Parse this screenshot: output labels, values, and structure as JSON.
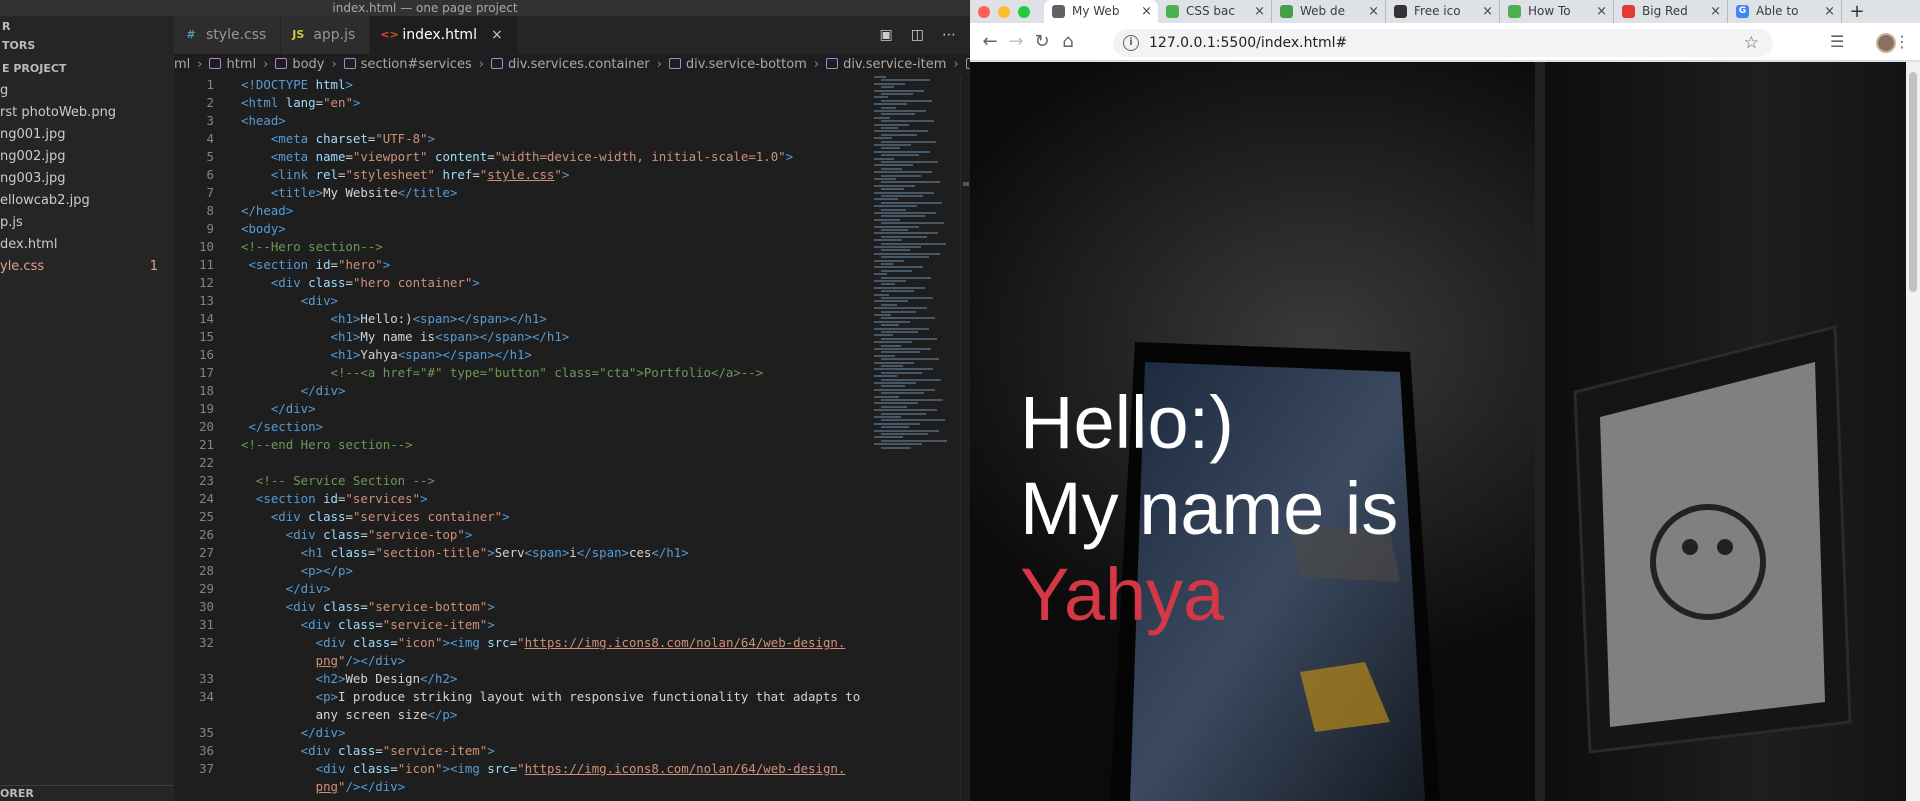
{
  "vscode": {
    "window_title": "index.html — one page project",
    "sidebar": {
      "header": "R",
      "open_editors": "TORS",
      "project": "E PROJECT",
      "files": [
        {
          "name": "g",
          "modified": false,
          "count": ""
        },
        {
          "name": "rst photoWeb.png",
          "modified": false,
          "count": ""
        },
        {
          "name": "ng001.jpg",
          "modified": false,
          "count": ""
        },
        {
          "name": "ng002.jpg",
          "modified": false,
          "count": ""
        },
        {
          "name": "ng003.jpg",
          "modified": false,
          "count": ""
        },
        {
          "name": "ellowcab2.jpg",
          "modified": false,
          "count": ""
        },
        {
          "name": "p.js",
          "modified": false,
          "count": ""
        },
        {
          "name": "dex.html",
          "modified": false,
          "count": ""
        },
        {
          "name": "yle.css",
          "modified": true,
          "count": "1"
        }
      ],
      "outline": "ORER"
    },
    "tabs": [
      {
        "label": "style.css",
        "icon": "css-file-icon",
        "glyph": "#",
        "color": "#519aba",
        "active": false
      },
      {
        "label": "app.js",
        "icon": "js-file-icon",
        "glyph": "JS",
        "color": "#cbcb41",
        "active": false
      },
      {
        "label": "index.html",
        "icon": "html-file-icon",
        "glyph": "<>",
        "color": "#e44d26",
        "active": true
      }
    ],
    "breadcrumb": [
      "ml",
      "html",
      "body",
      "section#services",
      "div.services.container",
      "div.service-bottom",
      "div.service-item",
      "p"
    ],
    "lines": [
      {
        "n": "1",
        "tokens": [
          [
            "tag",
            "<!DOCTYPE "
          ],
          [
            "attr",
            "html"
          ],
          [
            "tag",
            ">"
          ]
        ]
      },
      {
        "n": "2",
        "tokens": [
          [
            "tag",
            "<html "
          ],
          [
            "attr",
            "lang"
          ],
          [
            "txt",
            "="
          ],
          [
            "str",
            "\"en\""
          ],
          [
            "tag",
            ">"
          ]
        ]
      },
      {
        "n": "3",
        "tokens": [
          [
            "tag",
            "<head>"
          ]
        ]
      },
      {
        "n": "4",
        "tokens": [
          [
            "txt",
            "    "
          ],
          [
            "tag",
            "<meta "
          ],
          [
            "attr",
            "charset"
          ],
          [
            "txt",
            "="
          ],
          [
            "str",
            "\"UTF-8\""
          ],
          [
            "tag",
            ">"
          ]
        ]
      },
      {
        "n": "5",
        "tokens": [
          [
            "txt",
            "    "
          ],
          [
            "tag",
            "<meta "
          ],
          [
            "attr",
            "name"
          ],
          [
            "txt",
            "="
          ],
          [
            "str",
            "\"viewport\""
          ],
          [
            "txt",
            " "
          ],
          [
            "attr",
            "content"
          ],
          [
            "txt",
            "="
          ],
          [
            "str",
            "\"width=device-width, initial-scale=1.0\""
          ],
          [
            "tag",
            ">"
          ]
        ]
      },
      {
        "n": "6",
        "tokens": [
          [
            "txt",
            "    "
          ],
          [
            "tag",
            "<link "
          ],
          [
            "attr",
            "rel"
          ],
          [
            "txt",
            "="
          ],
          [
            "str",
            "\"stylesheet\""
          ],
          [
            "txt",
            " "
          ],
          [
            "attr",
            "href"
          ],
          [
            "txt",
            "="
          ],
          [
            "str",
            "\""
          ],
          [
            "url",
            "style.css"
          ],
          [
            "str",
            "\""
          ],
          [
            "tag",
            ">"
          ]
        ]
      },
      {
        "n": "7",
        "tokens": [
          [
            "txt",
            "    "
          ],
          [
            "tag",
            "<title>"
          ],
          [
            "txt",
            "My Website"
          ],
          [
            "tag",
            "</title>"
          ]
        ]
      },
      {
        "n": "8",
        "tokens": [
          [
            "tag",
            "</head>"
          ]
        ]
      },
      {
        "n": "9",
        "tokens": [
          [
            "tag",
            "<body>"
          ]
        ]
      },
      {
        "n": "10",
        "tokens": [
          [
            "cm",
            "<!--Hero section-->"
          ]
        ]
      },
      {
        "n": "11",
        "tokens": [
          [
            "txt",
            " "
          ],
          [
            "tag",
            "<section "
          ],
          [
            "attr",
            "id"
          ],
          [
            "txt",
            "="
          ],
          [
            "str",
            "\"hero\""
          ],
          [
            "tag",
            ">"
          ]
        ]
      },
      {
        "n": "12",
        "tokens": [
          [
            "txt",
            "    "
          ],
          [
            "tag",
            "<div "
          ],
          [
            "attr",
            "class"
          ],
          [
            "txt",
            "="
          ],
          [
            "str",
            "\"hero container\""
          ],
          [
            "tag",
            ">"
          ]
        ]
      },
      {
        "n": "13",
        "tokens": [
          [
            "txt",
            "        "
          ],
          [
            "tag",
            "<div>"
          ]
        ]
      },
      {
        "n": "14",
        "tokens": [
          [
            "txt",
            "            "
          ],
          [
            "tag",
            "<h1>"
          ],
          [
            "txt",
            "Hello:)"
          ],
          [
            "tag",
            "<span></span></h1>"
          ]
        ]
      },
      {
        "n": "15",
        "tokens": [
          [
            "txt",
            "            "
          ],
          [
            "tag",
            "<h1>"
          ],
          [
            "txt",
            "My name is"
          ],
          [
            "tag",
            "<span></span></h1>"
          ]
        ]
      },
      {
        "n": "16",
        "tokens": [
          [
            "txt",
            "            "
          ],
          [
            "tag",
            "<h1>"
          ],
          [
            "txt",
            "Yahya"
          ],
          [
            "tag",
            "<span></span></h1>"
          ]
        ]
      },
      {
        "n": "17",
        "tokens": [
          [
            "txt",
            "            "
          ],
          [
            "cm",
            "<!--<a href=\"#\" type=\"button\" class=\"cta\">Portfolio</a>-->"
          ]
        ]
      },
      {
        "n": "18",
        "tokens": [
          [
            "txt",
            "        "
          ],
          [
            "tag",
            "</div>"
          ]
        ]
      },
      {
        "n": "19",
        "tokens": [
          [
            "txt",
            "    "
          ],
          [
            "tag",
            "</div>"
          ]
        ]
      },
      {
        "n": "20",
        "tokens": [
          [
            "txt",
            " "
          ],
          [
            "tag",
            "</section>"
          ]
        ]
      },
      {
        "n": "21",
        "tokens": [
          [
            "cm",
            "<!--end Hero section-->"
          ]
        ]
      },
      {
        "n": "22",
        "tokens": []
      },
      {
        "n": "23",
        "tokens": [
          [
            "txt",
            "  "
          ],
          [
            "cm",
            "<!-- Service Section -->"
          ]
        ]
      },
      {
        "n": "24",
        "tokens": [
          [
            "txt",
            "  "
          ],
          [
            "tag",
            "<section "
          ],
          [
            "attr",
            "id"
          ],
          [
            "txt",
            "="
          ],
          [
            "str",
            "\"services\""
          ],
          [
            "tag",
            ">"
          ]
        ]
      },
      {
        "n": "25",
        "tokens": [
          [
            "txt",
            "    "
          ],
          [
            "tag",
            "<div "
          ],
          [
            "attr",
            "class"
          ],
          [
            "txt",
            "="
          ],
          [
            "str",
            "\"services container\""
          ],
          [
            "tag",
            ">"
          ]
        ]
      },
      {
        "n": "26",
        "tokens": [
          [
            "txt",
            "      "
          ],
          [
            "tag",
            "<div "
          ],
          [
            "attr",
            "class"
          ],
          [
            "txt",
            "="
          ],
          [
            "str",
            "\"service-top\""
          ],
          [
            "tag",
            ">"
          ]
        ]
      },
      {
        "n": "27",
        "tokens": [
          [
            "txt",
            "        "
          ],
          [
            "tag",
            "<h1 "
          ],
          [
            "attr",
            "class"
          ],
          [
            "txt",
            "="
          ],
          [
            "str",
            "\"section-title\""
          ],
          [
            "tag",
            ">"
          ],
          [
            "txt",
            "Serv"
          ],
          [
            "tag",
            "<span>"
          ],
          [
            "txt",
            "i"
          ],
          [
            "tag",
            "</span>"
          ],
          [
            "txt",
            "ces"
          ],
          [
            "tag",
            "</h1>"
          ]
        ]
      },
      {
        "n": "28",
        "tokens": [
          [
            "txt",
            "        "
          ],
          [
            "tag",
            "<p></p>"
          ]
        ]
      },
      {
        "n": "29",
        "tokens": [
          [
            "txt",
            "      "
          ],
          [
            "tag",
            "</div>"
          ]
        ]
      },
      {
        "n": "30",
        "tokens": [
          [
            "txt",
            "      "
          ],
          [
            "tag",
            "<div "
          ],
          [
            "attr",
            "class"
          ],
          [
            "txt",
            "="
          ],
          [
            "str",
            "\"service-bottom\""
          ],
          [
            "tag",
            ">"
          ]
        ]
      },
      {
        "n": "31",
        "tokens": [
          [
            "txt",
            "        "
          ],
          [
            "tag",
            "<div "
          ],
          [
            "attr",
            "class"
          ],
          [
            "txt",
            "="
          ],
          [
            "str",
            "\"service-item\""
          ],
          [
            "tag",
            ">"
          ]
        ]
      },
      {
        "n": "32",
        "tokens": [
          [
            "txt",
            "          "
          ],
          [
            "tag",
            "<div "
          ],
          [
            "attr",
            "class"
          ],
          [
            "txt",
            "="
          ],
          [
            "str",
            "\"icon\""
          ],
          [
            "tag",
            ">"
          ],
          [
            "tag",
            "<img "
          ],
          [
            "attr",
            "src"
          ],
          [
            "txt",
            "="
          ],
          [
            "str",
            "\""
          ],
          [
            "url",
            "https://img.icons8.com/nolan/64/web-design."
          ]
        ]
      },
      {
        "n": "",
        "tokens": [
          [
            "txt",
            "          "
          ],
          [
            "url",
            "png"
          ],
          [
            "str",
            "\""
          ],
          [
            "tag",
            "/></div>"
          ]
        ]
      },
      {
        "n": "33",
        "tokens": [
          [
            "txt",
            "          "
          ],
          [
            "tag",
            "<h2>"
          ],
          [
            "txt",
            "Web Design"
          ],
          [
            "tag",
            "</h2>"
          ]
        ]
      },
      {
        "n": "34",
        "tokens": [
          [
            "txt",
            "          "
          ],
          [
            "tag",
            "<p>"
          ],
          [
            "txt",
            "I produce striking layout with responsive functionality that adapts to"
          ]
        ]
      },
      {
        "n": "",
        "tokens": [
          [
            "txt",
            "          any screen size"
          ],
          [
            "tag",
            "</p>"
          ]
        ]
      },
      {
        "n": "35",
        "tokens": [
          [
            "txt",
            "        "
          ],
          [
            "tag",
            "</div>"
          ]
        ]
      },
      {
        "n": "36",
        "tokens": [
          [
            "txt",
            "        "
          ],
          [
            "tag",
            "<div "
          ],
          [
            "attr",
            "class"
          ],
          [
            "txt",
            "="
          ],
          [
            "str",
            "\"service-item\""
          ],
          [
            "tag",
            ">"
          ]
        ]
      },
      {
        "n": "37",
        "tokens": [
          [
            "txt",
            "          "
          ],
          [
            "tag",
            "<div "
          ],
          [
            "attr",
            "class"
          ],
          [
            "txt",
            "="
          ],
          [
            "str",
            "\"icon\""
          ],
          [
            "tag",
            ">"
          ],
          [
            "tag",
            "<img "
          ],
          [
            "attr",
            "src"
          ],
          [
            "txt",
            "="
          ],
          [
            "str",
            "\""
          ],
          [
            "url",
            "https://img.icons8.com/nolan/64/web-design."
          ]
        ]
      },
      {
        "n": "",
        "tokens": [
          [
            "txt",
            "          "
          ],
          [
            "url",
            "png"
          ],
          [
            "str",
            "\""
          ],
          [
            "tag",
            "/></div>"
          ]
        ]
      }
    ]
  },
  "chrome": {
    "tabs": [
      {
        "label": "My Web",
        "active": true,
        "fav": "",
        "fav_color": "#5f6368"
      },
      {
        "label": "CSS bac",
        "active": false,
        "fav": "",
        "fav_color": "#4caf50"
      },
      {
        "label": "Web de",
        "active": false,
        "fav": "",
        "fav_color": "#43a047"
      },
      {
        "label": "Free ico",
        "active": false,
        "fav": "",
        "fav_color": "#333333"
      },
      {
        "label": "How To",
        "active": false,
        "fav": "",
        "fav_color": "#4caf50"
      },
      {
        "label": "Big Red",
        "active": false,
        "fav": "",
        "fav_color": "#e53935"
      },
      {
        "label": "Able to",
        "active": false,
        "fav": "G",
        "fav_color": "#4285f4"
      }
    ],
    "url": "127.0.0.1:5500/index.html#",
    "hero": {
      "line1": "Hello:)",
      "line2": "My name is",
      "line3": "Yahya"
    },
    "colors": {
      "accent": "#d43846",
      "text": "#ffffff"
    }
  }
}
